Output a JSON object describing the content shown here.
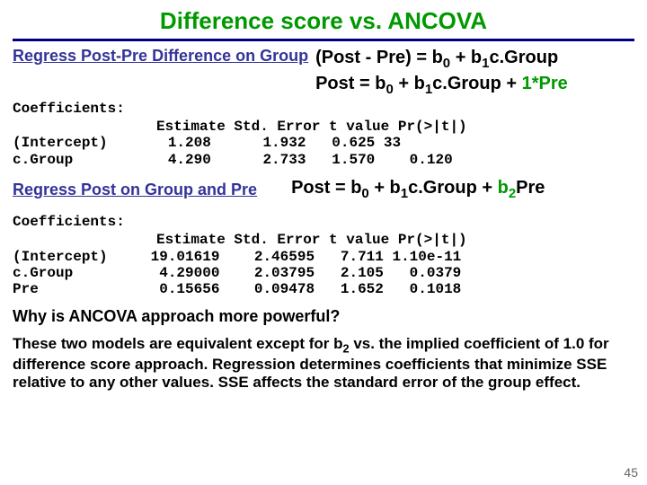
{
  "title": "Difference score vs. ANCOVA",
  "section1": "Regress Post-Pre Difference on Group",
  "eq1a_pre": "(Post - Pre) = b",
  "eq1a_mid": " + b",
  "eq1a_end": "c.Group",
  "eq1b_pre": "Post = b",
  "eq1b_mid": " + b",
  "eq1b_grp": "c.Group + ",
  "eq1b_one": "1*Pre",
  "coef_label": "Coefficients:",
  "tbl1_header": "Estimate Std. Error t value Pr(>|t|)",
  "tbl1_row1": "(Intercept)       1.208      1.932   0.625 33",
  "tbl1_row2": "c.Group           4.290      2.733   1.570    0.120",
  "section2": "Regress Post on Group and Pre",
  "eq2_pre": "Post = b",
  "eq2_mid": " + b",
  "eq2_grp": "c.Group + ",
  "eq2_b2": "b",
  "eq2_pre2": "Pre",
  "tbl2_header": "Estimate Std. Error t value Pr(>|t|)",
  "tbl2_row1": "(Intercept)     19.01619    2.46595   7.711 1.10e-11",
  "tbl2_row2": "c.Group          4.29000    2.03795   2.105   0.0379",
  "tbl2_row3": "Pre              0.15656    0.09478   1.652   0.1018",
  "why": "Why is ANCOVA approach more powerful?",
  "body1": "These two models are equivalent except for b",
  "body2": " vs. the implied coefficient of 1.0 for difference score approach. Regression determines coefficients that minimize SSE relative to any other values.   SSE affects the standard error of the group effect.",
  "sub0": "0",
  "sub1": "1",
  "sub2": "2",
  "pagenum": "45"
}
